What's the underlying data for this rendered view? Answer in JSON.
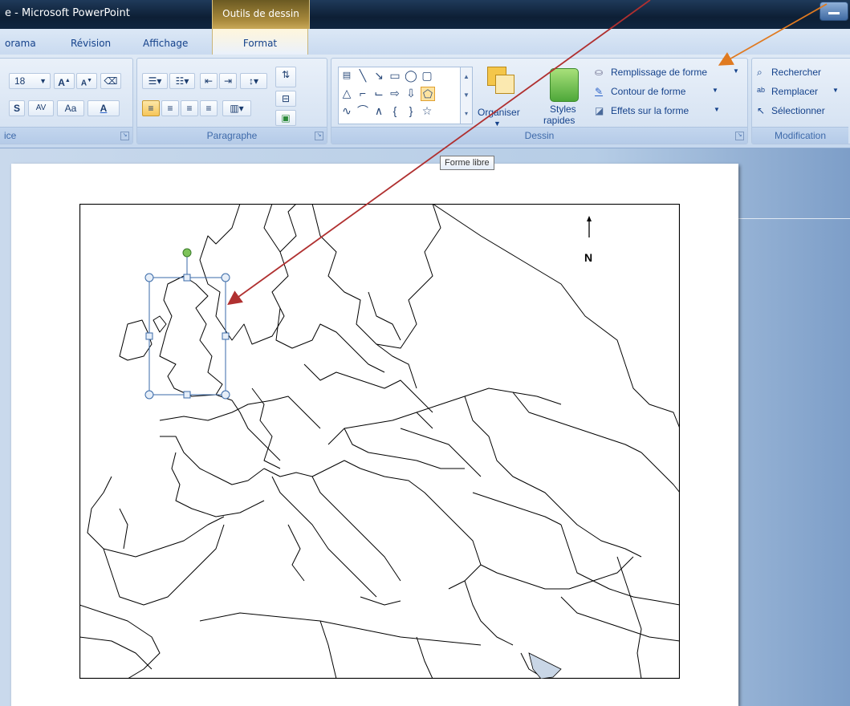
{
  "window": {
    "title": "e - Microsoft PowerPoint",
    "context_tab": "Outils de dessin"
  },
  "tabs": [
    "orama",
    "Révision",
    "Affichage",
    "Format"
  ],
  "ribbon": {
    "font": {
      "size": "18",
      "group_label": "ice",
      "bold_label": "S",
      "spacing_label": "AV",
      "case_label": "Aa",
      "color_label": "A"
    },
    "paragraph": {
      "group_label": "Paragraphe"
    },
    "drawing": {
      "group_label": "Dessin",
      "organize": "Organiser",
      "quick_styles_1": "Styles",
      "quick_styles_2": "rapides",
      "fill": "Remplissage de forme",
      "outline": "Contour de forme",
      "effects": "Effets sur la forme"
    },
    "editing": {
      "group_label": "Modification",
      "find": "Rechercher",
      "replace": "Remplacer",
      "select": "Sélectionner"
    }
  },
  "tooltip": "Forme libre",
  "map": {
    "north_label": "N"
  },
  "colors": {
    "arrow_red": "#b03030",
    "arrow_orange": "#e07a20",
    "selection": "#3a6aa8"
  }
}
